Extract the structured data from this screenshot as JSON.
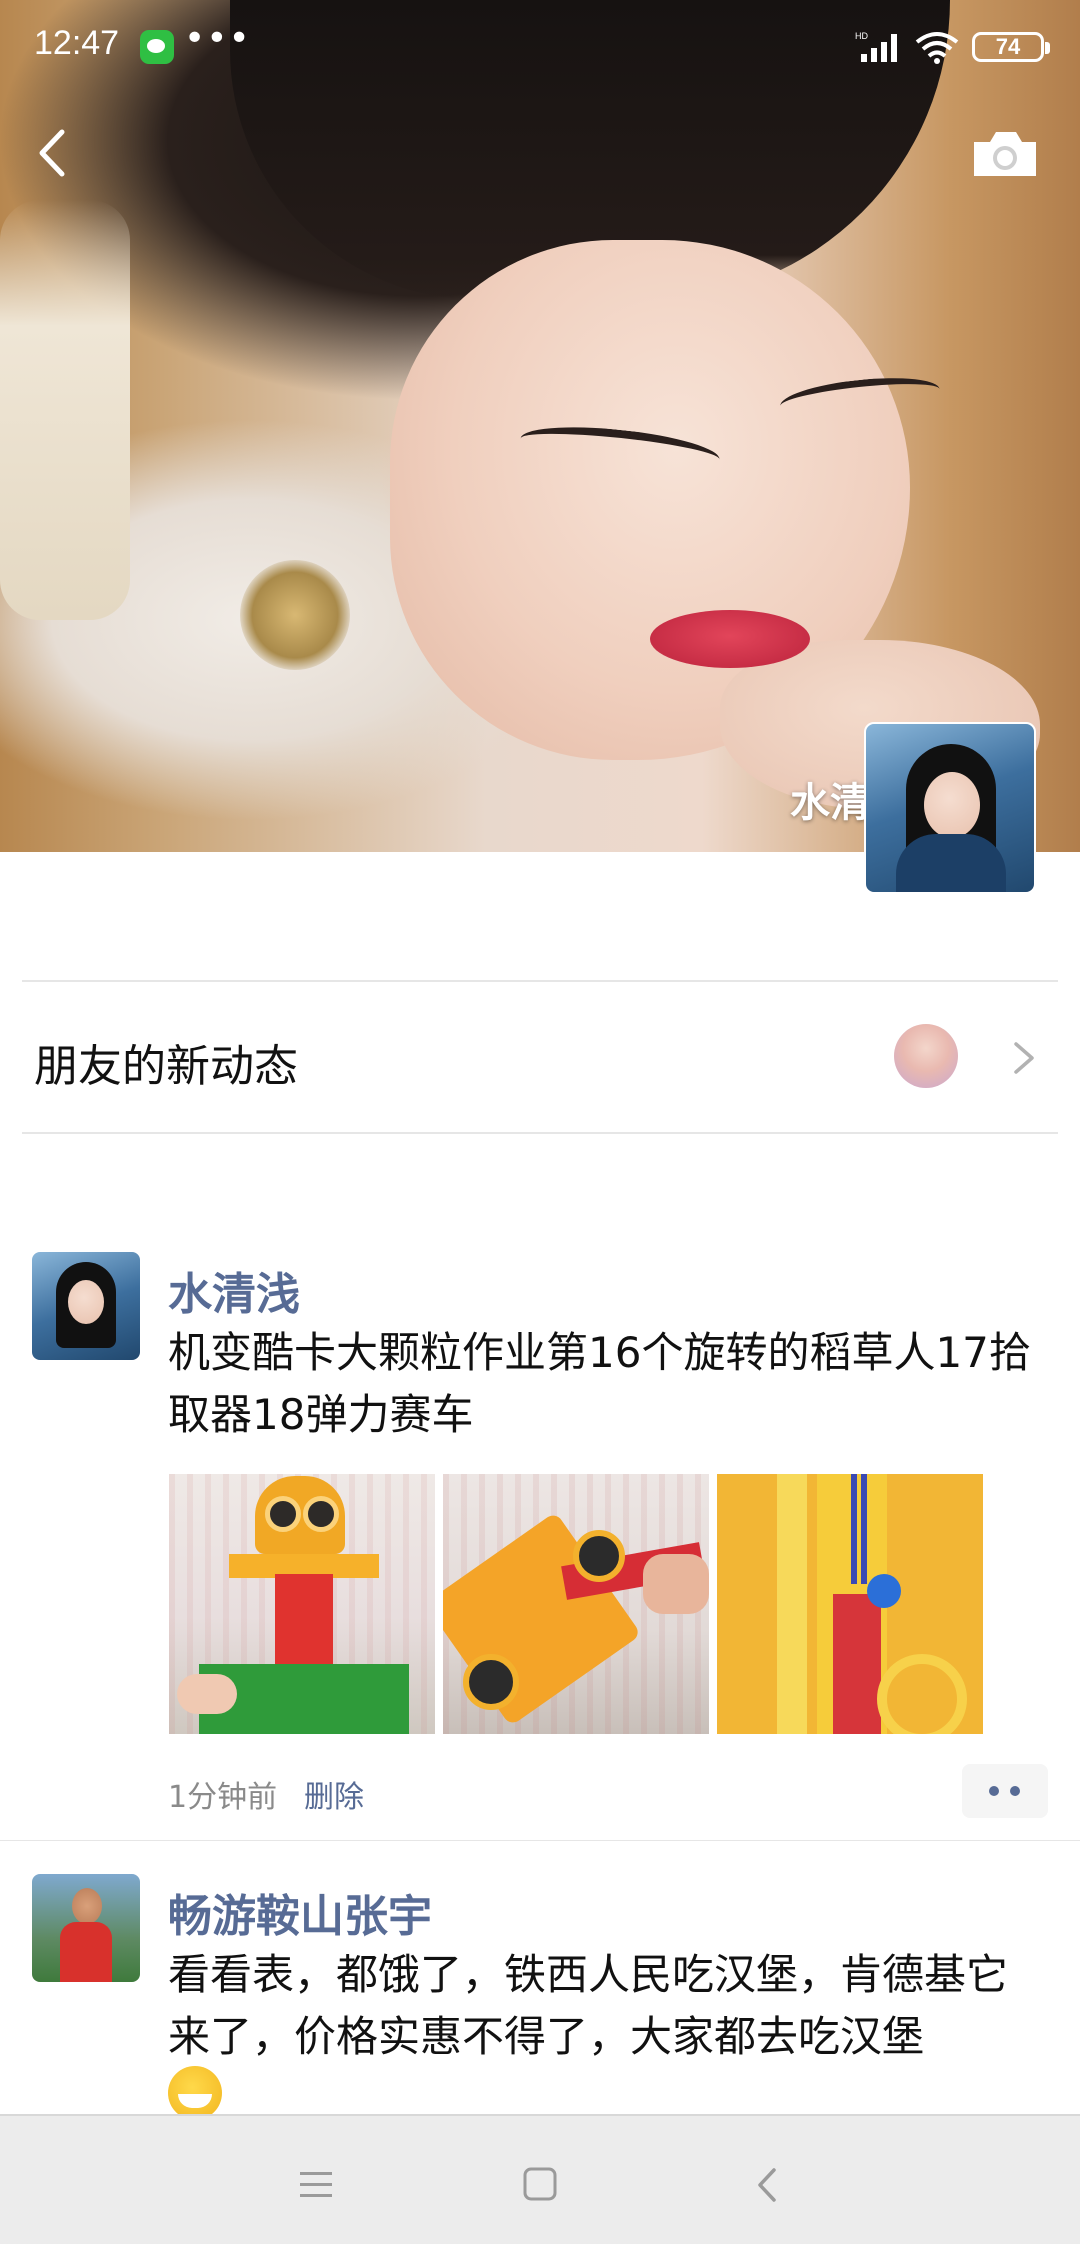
{
  "status_bar": {
    "time": "12:47",
    "more_dots": "•••",
    "network_label": "HD",
    "battery": "74"
  },
  "header": {
    "back_icon": "chevron-left-icon",
    "camera_icon": "camera-icon",
    "profile_name": "水清浅"
  },
  "friends_updates": {
    "label": "朋友的新动态"
  },
  "posts": [
    {
      "author": "水清浅",
      "text": "机变酷卡大颗粒作业第16个旋转的稻草人17拾取器18弹力赛车",
      "photo_count": 3,
      "time": "1分钟前",
      "delete_label": "删除",
      "more_icon": "more-dots-icon"
    },
    {
      "author": "畅游鞍山张宇",
      "text": "看看表，都饿了，铁西人民吃汉堡，肯德基它来了，价格实惠不得了，大家都去吃汉堡",
      "emoji": "grin-emoji"
    }
  ],
  "nav_bar": {
    "menu_icon": "menu-icon",
    "home_icon": "home-square-icon",
    "back_icon": "back-triangle-icon"
  },
  "colors": {
    "link_blue": "#576b95",
    "divider": "#e6e6e6",
    "wechat_green": "#2fbf43"
  }
}
